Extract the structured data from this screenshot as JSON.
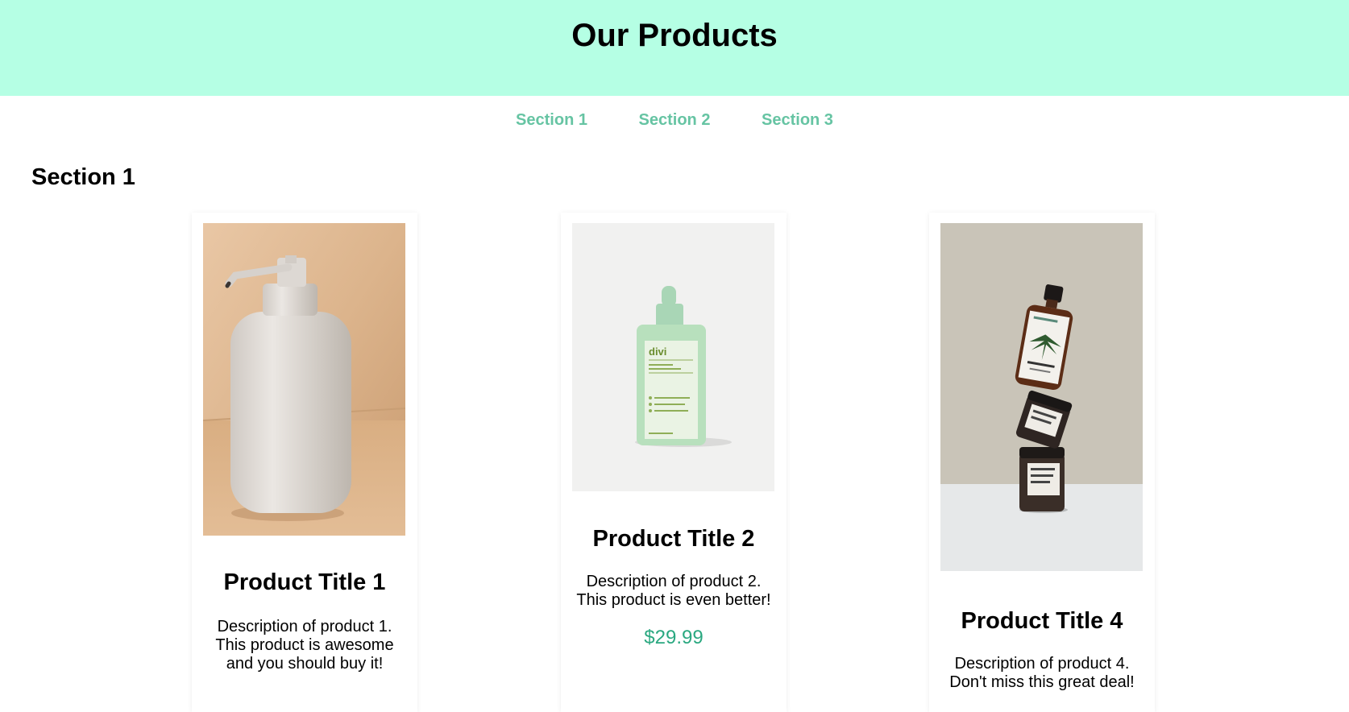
{
  "header": {
    "title": "Our Products"
  },
  "nav": {
    "items": [
      "Section 1",
      "Section 2",
      "Section 3"
    ]
  },
  "section": {
    "title": "Section 1"
  },
  "products": [
    {
      "title": "Product Title 1",
      "description": "Description of product 1. This product is awesome and you should buy it!",
      "image_name": "soap-dispenser-image"
    },
    {
      "title": "Product Title 2",
      "description": "Description of product 2. This product is even better!",
      "price": "$29.99",
      "image_name": "serum-bottle-image",
      "image_brand": "divi"
    },
    {
      "title": "Product Title 4",
      "description": "Description of product 4. Don't miss this great deal!",
      "image_name": "stacked-jars-image"
    }
  ],
  "colors": {
    "header_bg": "#b5ffe4",
    "nav_link": "#66c4a3",
    "price": "#2aa880"
  }
}
